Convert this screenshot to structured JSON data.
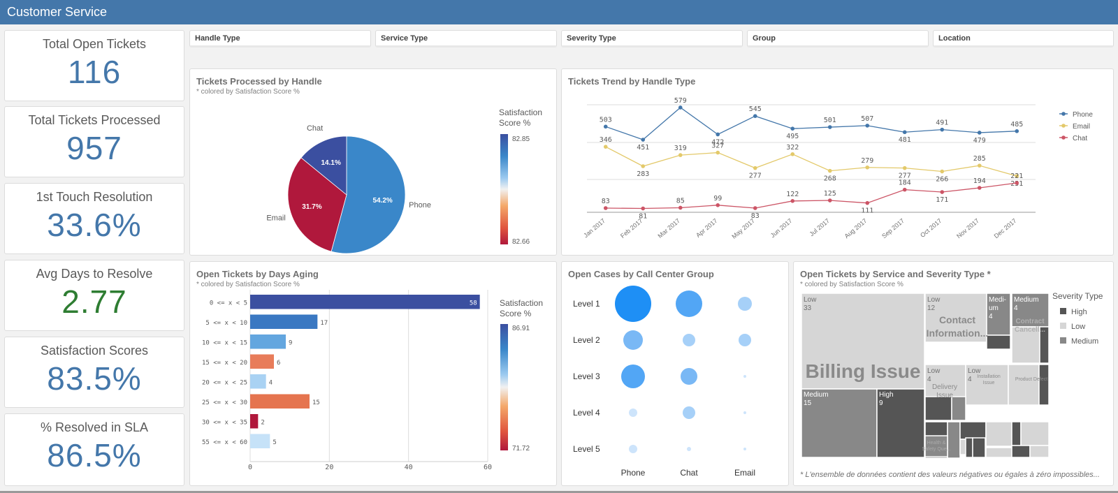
{
  "header": {
    "title": "Customer Service"
  },
  "kpis": [
    {
      "label": "Total Open Tickets",
      "value": "116",
      "color": "#4477aa"
    },
    {
      "label": "Total Tickets Processed",
      "value": "957",
      "color": "#4477aa"
    },
    {
      "label": "1st Touch Resolution",
      "value": "33.6%",
      "color": "#4477aa"
    },
    {
      "label": "Avg Days to Resolve",
      "value": "2.77",
      "color": "#2e7d32"
    },
    {
      "label": "Satisfaction Scores",
      "value": "83.5%",
      "color": "#4477aa"
    },
    {
      "label": "% Resolved in SLA",
      "value": "86.5%",
      "color": "#4477aa"
    }
  ],
  "filters": [
    "Handle Type",
    "Service Type",
    "Severity Type",
    "Group",
    "Location"
  ],
  "chart_data": [
    {
      "type": "pie",
      "title": "Tickets Processed by Handle",
      "subtitle": "* colored by Satisfaction Score %",
      "slices": [
        {
          "label": "Phone",
          "value": 54.2,
          "value_label": "54.2%",
          "color": "#3a87c9"
        },
        {
          "label": "Email",
          "value": 31.7,
          "value_label": "31.7%",
          "color": "#b0183c"
        },
        {
          "label": "Chat",
          "value": 14.1,
          "value_label": "14.1%",
          "color": "#3b4fa0"
        }
      ],
      "legend": {
        "title": "Satisfaction Score %",
        "max": "82.85",
        "min": "82.66",
        "placement": "right"
      }
    },
    {
      "type": "line",
      "title": "Tickets Trend by Handle Type",
      "categories": [
        "Jan 2017",
        "Feb 2017",
        "Mar 2017",
        "Apr 2017",
        "May 2017",
        "Jun 2017",
        "Jul 2017",
        "Aug 2017",
        "Sep 2017",
        "Oct 2017",
        "Nov 2017",
        "Dec 2017"
      ],
      "series": [
        {
          "name": "Phone",
          "color": "#4477aa",
          "values": [
            503,
            451,
            579,
            472,
            545,
            495,
            501,
            507,
            481,
            491,
            479,
            485
          ]
        },
        {
          "name": "Email",
          "color": "#e3c96a",
          "values": [
            346,
            283,
            319,
            327,
            277,
            322,
            268,
            279,
            277,
            266,
            285,
            251
          ]
        },
        {
          "name": "Chat",
          "color": "#cc5566",
          "values": [
            83,
            81,
            85,
            99,
            83,
            122,
            125,
            111,
            184,
            171,
            194,
            221
          ]
        }
      ],
      "legend_placement": "top-right"
    },
    {
      "type": "bar",
      "orientation": "horizontal",
      "title": "Open Tickets by Days Aging",
      "subtitle": "* colored by Satisfaction Score %",
      "categories": [
        "0 <= x < 5",
        "5 <= x < 10",
        "10 <= x < 15",
        "15 <= x < 20",
        "20 <= x < 25",
        "25 <= x < 30",
        "30 <= x < 35",
        "55 <= x < 60"
      ],
      "values": [
        58,
        17,
        9,
        6,
        4,
        15,
        2,
        5
      ],
      "colors": [
        "#3b4fa0",
        "#3a78c2",
        "#63a6df",
        "#e87c5a",
        "#a9d2f3",
        "#e5744f",
        "#b0183c",
        "#c6e2f8"
      ],
      "xticks": [
        "0",
        "20",
        "40",
        "60"
      ],
      "xlim": [
        0,
        60
      ],
      "legend": {
        "title": "Satisfaction Score %",
        "max": "86.91",
        "min": "71.72",
        "placement": "right"
      }
    },
    {
      "type": "scatter",
      "title": "Open Cases by Call Center Group",
      "rows": [
        "Level 1",
        "Level 2",
        "Level 3",
        "Level 4",
        "Level 5"
      ],
      "columns": [
        "Phone",
        "Chat",
        "Email"
      ],
      "sizes": [
        [
          26,
          19,
          10
        ],
        [
          14,
          9,
          9
        ],
        [
          17,
          12,
          2
        ],
        [
          6,
          9,
          2
        ],
        [
          6,
          3,
          2
        ]
      ]
    },
    {
      "type": "treemap",
      "title": "Open Tickets by Service and Severity Type *",
      "subtitle": "* colored by Satisfaction Score %",
      "legend": {
        "title": "Severity Type",
        "items": [
          {
            "label": "High",
            "color": "#555555"
          },
          {
            "label": "Low",
            "color": "#d6d6d6"
          },
          {
            "label": "Medium",
            "color": "#888888"
          }
        ]
      },
      "groups": [
        {
          "name": "Billing Issue",
          "cells": [
            {
              "sev": "Low",
              "value": 33
            },
            {
              "sev": "Medium",
              "value": 15
            },
            {
              "sev": "High",
              "value": 9
            }
          ]
        },
        {
          "name": "Contact Information...",
          "cells": [
            {
              "sev": "Low",
              "value": 12
            },
            {
              "sev": "Medi-um",
              "value": 4
            }
          ]
        },
        {
          "name": "Contract Cancell...",
          "cells": [
            {
              "sev": "Medium",
              "value": 4
            }
          ]
        },
        {
          "name": "Delivery Issue",
          "cells": [
            {
              "sev": "Low",
              "value": 4
            }
          ]
        },
        {
          "name": "Installation Issue",
          "cells": [
            {
              "sev": "Low",
              "value": 4
            }
          ]
        },
        {
          "name": "Product Defect",
          "cells": []
        },
        {
          "name": "Health & Safety Que...",
          "cells": []
        }
      ],
      "footnote": "* L'ensemble de données contient des valeurs négatives ou égales à zéro impossibles..."
    }
  ]
}
